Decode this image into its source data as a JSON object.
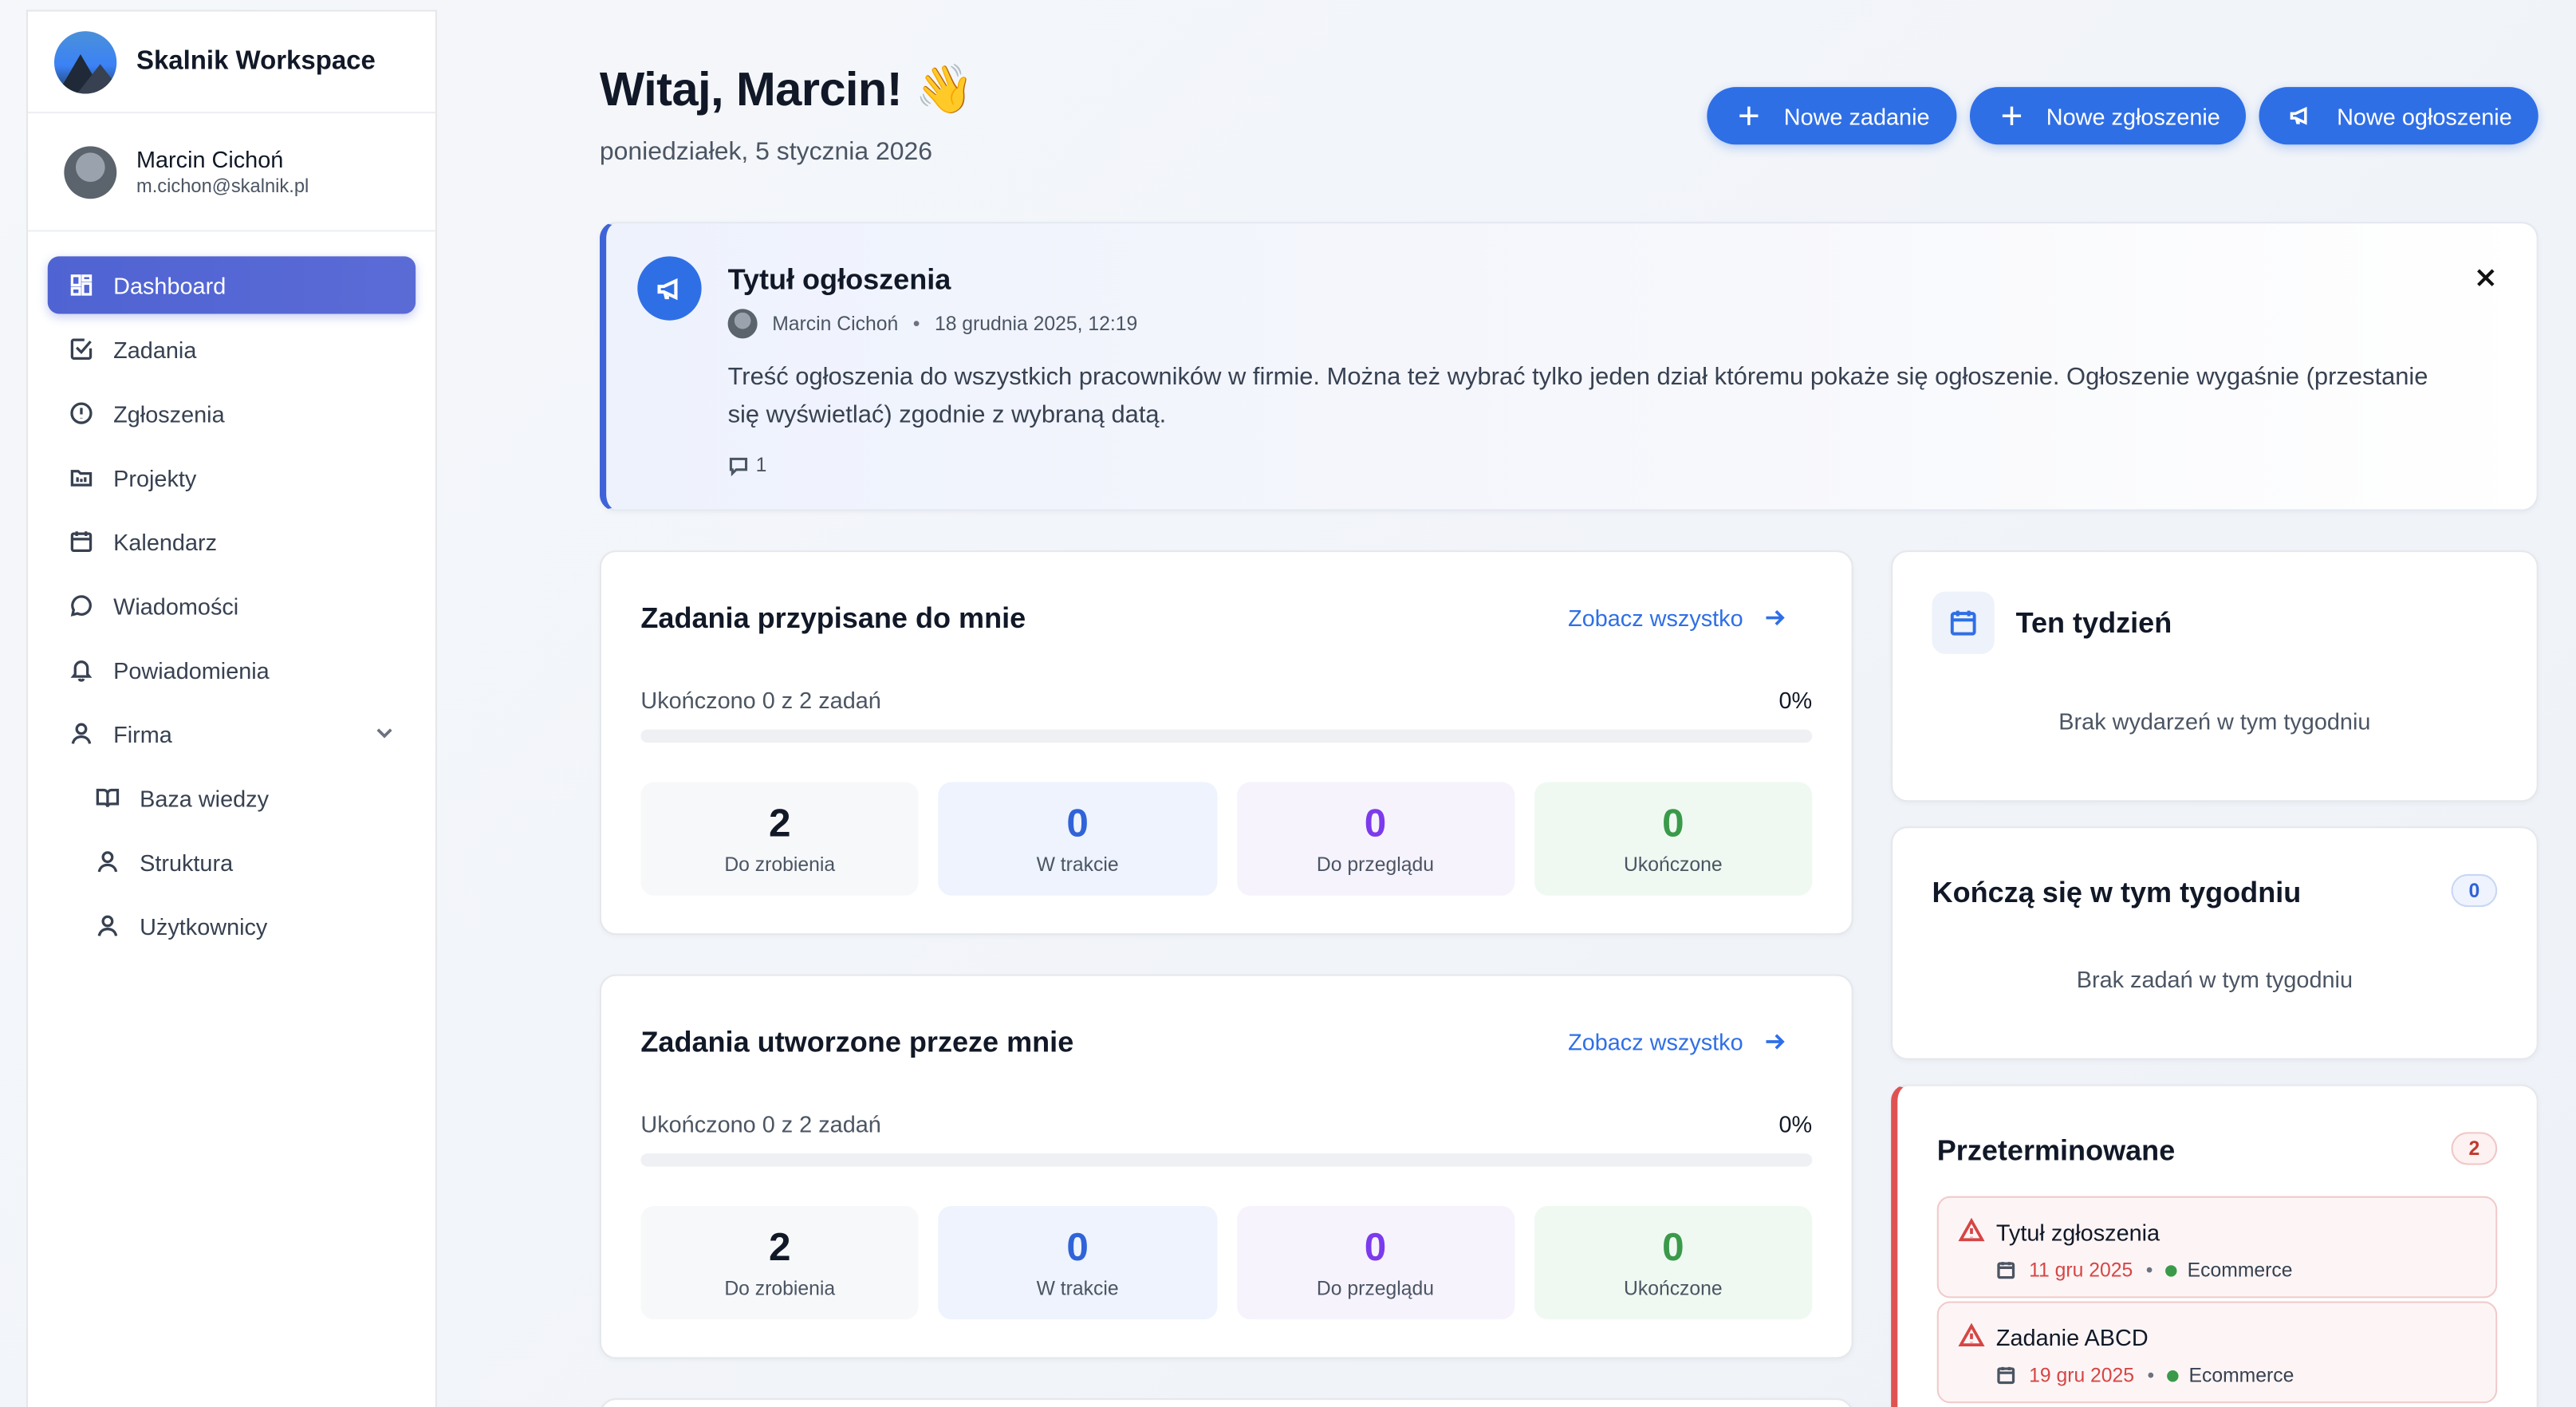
{
  "app": {
    "name": "Skalnik Workspace"
  },
  "user": {
    "name": "Marcin Cichoń",
    "email": "m.cichon@skalnik.pl"
  },
  "nav": {
    "dashboard": "Dashboard",
    "tasks": "Zadania",
    "tickets": "Zgłoszenia",
    "projects": "Projekty",
    "calendar": "Kalendarz",
    "messages": "Wiadomości",
    "notifications": "Powiadomienia",
    "company": "Firma",
    "knowledge": "Baza wiedzy",
    "structure": "Struktura",
    "users": "Użytkownicy"
  },
  "header": {
    "greeting": "Witaj, Marcin! 👋",
    "date": "poniedziałek, 5 stycznia 2026",
    "btn_task": "Nowe zadanie",
    "btn_ticket": "Nowe zgłoszenie",
    "btn_announcement": "Nowe ogłoszenie"
  },
  "announcement": {
    "title": "Tytuł ogłoszenia",
    "author": "Marcin Cichoń",
    "date": "18 grudnia 2025, 12:19",
    "separator": "•",
    "body": "Treść ogłoszenia do wszystkich pracowników w firmie. Można też wybrać tylko jeden dział któremu pokaże się ogłoszenie. Ogłoszenie wygaśnie (przestanie się wyświetlać) zgodnie z wybraną datą.",
    "comments": "1"
  },
  "assigned": {
    "title": "Zadania przypisane do mnie",
    "see_all": "Zobacz wszystko",
    "progress_label": "Ukończono 0 z 2 zadań",
    "progress_pct": "0%",
    "progress_value": 0,
    "stats": [
      {
        "value": "2",
        "label": "Do zrobienia"
      },
      {
        "value": "0",
        "label": "W trakcie"
      },
      {
        "value": "0",
        "label": "Do przeglądu"
      },
      {
        "value": "0",
        "label": "Ukończone"
      }
    ]
  },
  "created": {
    "title": "Zadania utworzone przeze mnie",
    "see_all": "Zobacz wszystko",
    "progress_label": "Ukończono 0 z 2 zadań",
    "progress_pct": "0%",
    "progress_value": 0,
    "stats": [
      {
        "value": "2",
        "label": "Do zrobienia"
      },
      {
        "value": "0",
        "label": "W trakcie"
      },
      {
        "value": "0",
        "label": "Do przeglądu"
      },
      {
        "value": "0",
        "label": "Ukończone"
      }
    ]
  },
  "week": {
    "title": "Ten tydzień",
    "empty": "Brak wydarzeń w tym tygodniu"
  },
  "ending": {
    "title": "Kończą się w tym tygodniu",
    "count": "0",
    "empty": "Brak zadań w tym tygodniu"
  },
  "overdue": {
    "title": "Przeterminowane",
    "count": "2",
    "items": [
      {
        "title": "Tytuł zgłoszenia",
        "date": "11 gru 2025",
        "category": "Ecommerce"
      },
      {
        "title": "Zadanie ABCD",
        "date": "19 gru 2025",
        "category": "Ecommerce"
      }
    ],
    "separator": "•"
  },
  "colors": {
    "accent": "#2f6fe6",
    "active_nav": "#4f63d2",
    "danger": "#d64545",
    "success": "#3a9a4a",
    "purple": "#7c3aed"
  },
  "icons": [
    "dashboard-icon",
    "tasks-icon",
    "tickets-icon",
    "projects-icon",
    "calendar-icon",
    "messages-icon",
    "bell-icon",
    "user-icon",
    "book-icon",
    "plus-icon",
    "megaphone-icon",
    "close-icon",
    "comment-icon",
    "arrow-right-icon",
    "warning-icon"
  ]
}
